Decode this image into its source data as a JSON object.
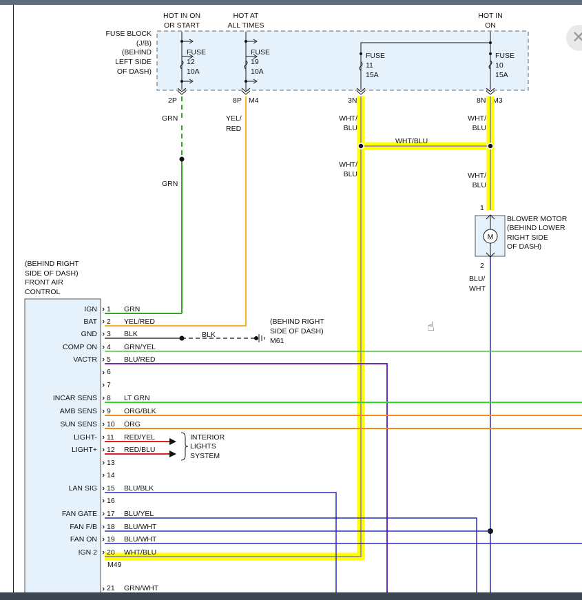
{
  "headers": {
    "hot_ign_start_1": "HOT IN ON",
    "hot_ign_start_2": "OR START",
    "hot_all_times_1": "HOT AT",
    "hot_all_times_2": "ALL TIMES",
    "hot_on_1": "HOT IN",
    "hot_on_2": "ON"
  },
  "fuse_block": {
    "lines": [
      "FUSE BLOCK",
      "(J/B)",
      "(BEHIND",
      "LEFT SIDE",
      "OF DASH)"
    ],
    "fuses": [
      {
        "label": "FUSE",
        "number": "12",
        "rating": "10A"
      },
      {
        "label": "FUSE",
        "number": "19",
        "rating": "10A"
      },
      {
        "label": "FUSE",
        "number": "11",
        "rating": "15A"
      },
      {
        "label": "FUSE",
        "number": "10",
        "rating": "15A"
      }
    ]
  },
  "pins": {
    "p2p": "2P",
    "p8p": "8P",
    "m4": "M4",
    "p3n": "3N",
    "p8n": "8N",
    "m3": "M3"
  },
  "wires": {
    "grn_upper": "GRN",
    "grn_lower": "GRN",
    "yel_1": "YEL/",
    "yel_2": "RED",
    "wht_a_1": "WHT/",
    "wht_a_2": "BLU",
    "wht_b_1": "WHT/",
    "wht_b_2": "BLU",
    "wht_c_1": "WHT/",
    "wht_c_2": "BLU",
    "wht_d_1": "WHT/",
    "wht_d_2": "BLU",
    "wht_bridge": "WHT/BLU",
    "blu_wht_1": "BLU/",
    "blu_wht_2": "WHT",
    "blk": "BLK"
  },
  "blower_motor": {
    "lines": [
      "BLOWER MOTOR",
      "(BEHIND LOWER",
      "RIGHT SIDE",
      "OF DASH)"
    ],
    "symbol": "M",
    "pin_top": "1",
    "pin_bottom": "2"
  },
  "ground": {
    "lines": [
      "(BEHIND RIGHT",
      "SIDE OF DASH)"
    ],
    "id": "M61"
  },
  "control": {
    "lines": [
      "(BEHIND RIGHT",
      "SIDE OF DASH)",
      "FRONT AIR",
      "CONTROL"
    ],
    "connector": "M49",
    "pins": [
      {
        "num": "1",
        "name": "IGN",
        "wire": "GRN"
      },
      {
        "num": "2",
        "name": "BAT",
        "wire": "YEL/RED"
      },
      {
        "num": "3",
        "name": "GND",
        "wire": "BLK"
      },
      {
        "num": "4",
        "name": "COMP ON",
        "wire": "GRN/YEL"
      },
      {
        "num": "5",
        "name": "VACTR",
        "wire": "BLU/RED"
      },
      {
        "num": "6",
        "name": "",
        "wire": ""
      },
      {
        "num": "7",
        "name": "",
        "wire": ""
      },
      {
        "num": "8",
        "name": "INCAR SENS",
        "wire": "LT GRN"
      },
      {
        "num": "9",
        "name": "AMB SENS",
        "wire": "ORG/BLK"
      },
      {
        "num": "10",
        "name": "SUN SENS",
        "wire": "ORG"
      },
      {
        "num": "11",
        "name": "LIGHT-",
        "wire": "RED/YEL"
      },
      {
        "num": "12",
        "name": "LIGHT+",
        "wire": "RED/BLU"
      },
      {
        "num": "13",
        "name": "",
        "wire": ""
      },
      {
        "num": "14",
        "name": "",
        "wire": ""
      },
      {
        "num": "15",
        "name": "LAN SIG",
        "wire": "BLU/BLK"
      },
      {
        "num": "16",
        "name": "",
        "wire": ""
      },
      {
        "num": "17",
        "name": "FAN GATE",
        "wire": "BLU/YEL"
      },
      {
        "num": "18",
        "name": "FAN F/B",
        "wire": "BLU/WHT"
      },
      {
        "num": "19",
        "name": "FAN ON",
        "wire": "BLU/WHT"
      },
      {
        "num": "20",
        "name": "IGN 2",
        "wire": "WHT/BLU"
      },
      {
        "num": "21",
        "name": "",
        "wire": "GRN/WHT"
      }
    ]
  },
  "interior_lights": [
    "INTERIOR",
    "LIGHTS",
    "SYSTEM"
  ],
  "colors": {
    "green": "#3aa02a",
    "bright_green": "#22dd22",
    "orange": "#f08a1c",
    "yellow_orange": "#f2b52a",
    "purple": "#6a2fb6",
    "blue": "#2a2ab8",
    "highlight": "#ffff00",
    "red": "#e02020"
  }
}
